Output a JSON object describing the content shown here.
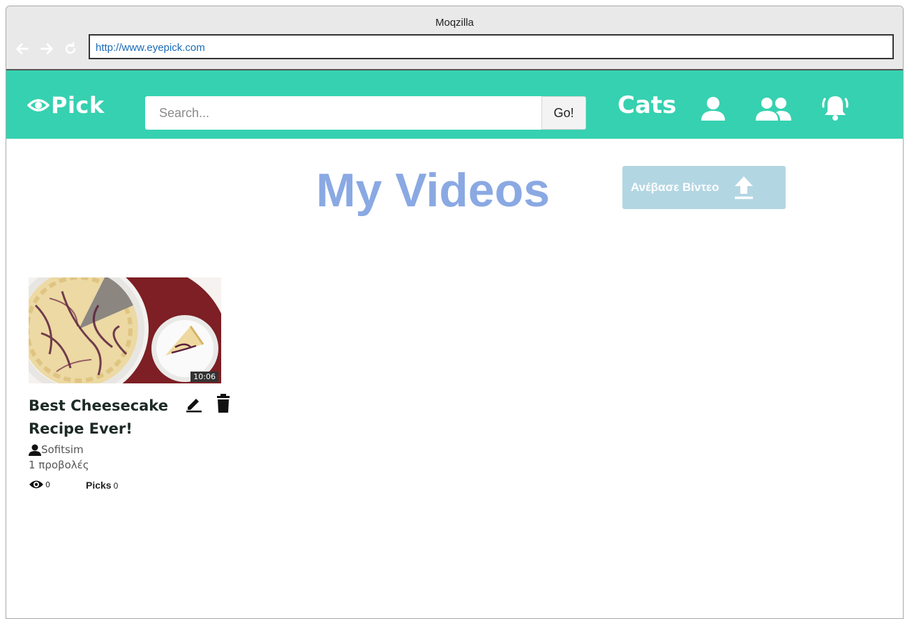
{
  "window": {
    "title": "Moqzilla"
  },
  "browser": {
    "url": "http://www.eyepick.com",
    "icons": {
      "back": "arrow-left-icon",
      "forward": "arrow-right-icon",
      "reload": "reload-icon"
    }
  },
  "header": {
    "logo": "Pick",
    "search_placeholder": "Search...",
    "go_label": "Go!",
    "cats_label": "Cats",
    "icons": [
      "user-icon",
      "users-icon",
      "bell-icon"
    ]
  },
  "main": {
    "title": "My Videos",
    "upload_label": "Ανέβασε Βίντεο"
  },
  "video": {
    "duration": "10:06",
    "title": "Best Cheesecake Recipe Ever!",
    "author": "Sofitsim",
    "views_text": "1 προβολές",
    "eye_count": "0",
    "picks_label": "Picks",
    "picks_count": "0"
  },
  "colors": {
    "accent": "#36d1b0",
    "title": "#8aa9e3",
    "upload_button": "#b3d6e3",
    "url_text": "#1a6bb5"
  }
}
